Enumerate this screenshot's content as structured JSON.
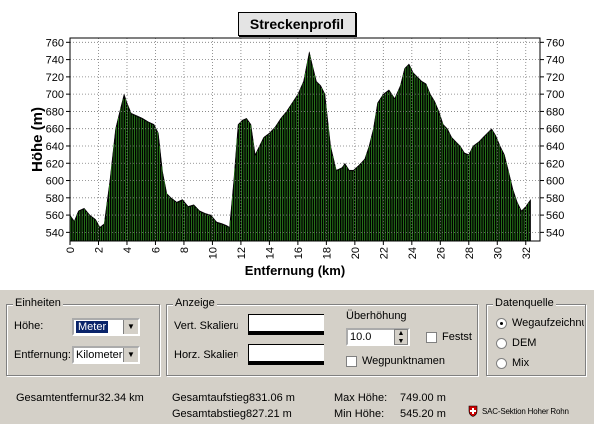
{
  "title": "Streckenprofil",
  "chart_data": {
    "type": "area",
    "title": "Streckenprofil",
    "xlabel": "Entfernung (km)",
    "ylabel": "Höhe (m)",
    "xlim": [
      0,
      33
    ],
    "ylim": [
      530,
      765
    ],
    "xticks": [
      "0",
      "2",
      "4",
      "6",
      "8",
      "10",
      "12",
      "14",
      "16",
      "18",
      "20",
      "22",
      "24",
      "26",
      "28",
      "30",
      "32"
    ],
    "yticks": [
      "540",
      "560",
      "580",
      "600",
      "620",
      "640",
      "660",
      "680",
      "700",
      "720",
      "740",
      "760"
    ],
    "grid": true,
    "x": [
      0,
      0.3,
      0.6,
      1.0,
      1.4,
      1.8,
      2.1,
      2.4,
      2.8,
      3.2,
      3.5,
      3.8,
      4.0,
      4.3,
      4.7,
      5.1,
      5.5,
      5.9,
      6.2,
      6.5,
      6.8,
      7.1,
      7.5,
      7.9,
      8.3,
      8.7,
      9.1,
      9.5,
      9.9,
      10.3,
      10.7,
      11.0,
      11.2,
      11.5,
      11.8,
      12.1,
      12.4,
      12.7,
      13.0,
      13.3,
      13.6,
      14.0,
      14.4,
      14.8,
      15.2,
      15.6,
      16.0,
      16.4,
      16.8,
      17.0,
      17.3,
      17.6,
      17.9,
      18.3,
      18.7,
      19.1,
      19.3,
      19.6,
      19.9,
      20.3,
      20.7,
      21.0,
      21.3,
      21.6,
      22.0,
      22.4,
      22.8,
      23.2,
      23.5,
      23.8,
      24.1,
      24.4,
      24.7,
      25.0,
      25.3,
      25.6,
      25.9,
      26.2,
      26.5,
      26.8,
      27.1,
      27.4,
      27.7,
      28.0,
      28.3,
      28.7,
      29.0,
      29.3,
      29.6,
      29.9,
      30.2,
      30.5,
      30.8,
      31.1,
      31.4,
      31.7,
      32.0,
      32.34
    ],
    "values": [
      560,
      553,
      565,
      568,
      560,
      555,
      546,
      550,
      600,
      660,
      680,
      700,
      690,
      678,
      675,
      672,
      668,
      665,
      655,
      610,
      585,
      580,
      575,
      578,
      570,
      572,
      565,
      562,
      560,
      552,
      550,
      548,
      546,
      600,
      665,
      670,
      672,
      665,
      630,
      640,
      650,
      655,
      662,
      672,
      680,
      690,
      700,
      715,
      749,
      735,
      715,
      710,
      700,
      640,
      612,
      615,
      620,
      612,
      612,
      618,
      625,
      640,
      660,
      690,
      700,
      705,
      695,
      710,
      730,
      735,
      725,
      720,
      715,
      712,
      700,
      692,
      680,
      665,
      660,
      650,
      645,
      640,
      632,
      630,
      640,
      645,
      650,
      655,
      660,
      652,
      640,
      630,
      610,
      590,
      575,
      565,
      570,
      578
    ]
  },
  "einheiten": {
    "legend": "Einheiten",
    "hoehe_label": "Höhe:",
    "hoehe_value": "Meter",
    "entfernung_label": "Entfernung:",
    "entfernung_value": "Kilometer"
  },
  "anzeige": {
    "legend": "Anzeige",
    "vert_label": "Vert. Skalieru",
    "horz_label": "Horz. Skalieru",
    "ueberhoehung_label": "Überhöhung",
    "ueberhoehung_value": "10.0",
    "fest_label": "Festst",
    "wegpunkt_label": "Wegpunktnamen"
  },
  "datenquelle": {
    "legend": "Datenquelle",
    "options": [
      "Wegaufzeichnu",
      "DEM",
      "Mix"
    ]
  },
  "stats": {
    "gesamtentfernung": "Gesamtentfernur32.34 km",
    "gesamtaufstieg": "Gesamtaufstieg831.06 m",
    "gesamtabstieg": "Gesamtabstieg827.21 m",
    "max_label": "Max Höhe:",
    "max_value": "749.00 m",
    "min_label": "Min Höhe:",
    "min_value": "545.20 m",
    "footer": "SAC-Sektion Hoher Rohn"
  }
}
